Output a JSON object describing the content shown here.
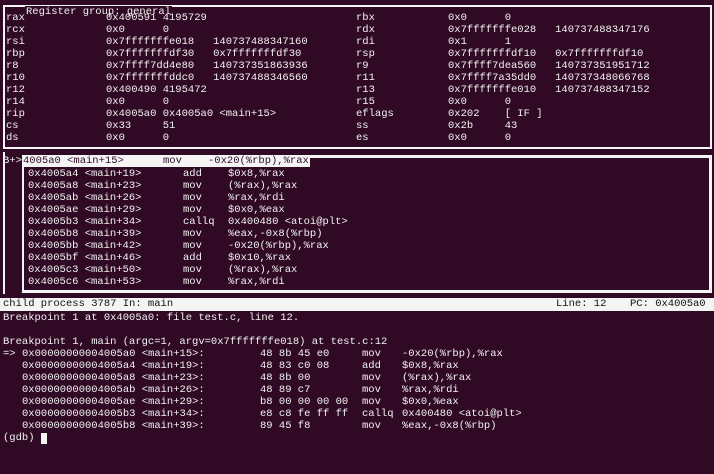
{
  "registers": {
    "title": "Register group: general",
    "left": [
      {
        "name": "rax",
        "value": "0x400591 4195729"
      },
      {
        "name": "rcx",
        "value": "0x0      0"
      },
      {
        "name": "rsi",
        "value": "0x7fffffffe018   140737488347160"
      },
      {
        "name": "rbp",
        "value": "0x7fffffffdf30   0x7fffffffdf30"
      },
      {
        "name": "r8",
        "value": "0x7ffff7dd4e80   140737351863936"
      },
      {
        "name": "r10",
        "value": "0x7fffffffddc0   140737488346560"
      },
      {
        "name": "r12",
        "value": "0x400490 4195472"
      },
      {
        "name": "r14",
        "value": "0x0      0"
      },
      {
        "name": "rip",
        "value": "0x4005a0 0x4005a0 <main+15>"
      },
      {
        "name": "cs",
        "value": "0x33     51"
      },
      {
        "name": "ds",
        "value": "0x0      0"
      }
    ],
    "right": [
      {
        "name": "rbx",
        "value": "0x0      0"
      },
      {
        "name": "rdx",
        "value": "0x7fffffffe028   140737488347176"
      },
      {
        "name": "rdi",
        "value": "0x1      1"
      },
      {
        "name": "rsp",
        "value": "0x7fffffffdf10   0x7fffffffdf10"
      },
      {
        "name": "r9",
        "value": "0x7ffff7dea560   140737351951712"
      },
      {
        "name": "r11",
        "value": "0x7ffff7a35dd0   140737348066768"
      },
      {
        "name": "r13",
        "value": "0x7fffffffe010   140737488347152"
      },
      {
        "name": "r15",
        "value": "0x0      0"
      },
      {
        "name": "eflags",
        "value": "0x202    [ IF ]"
      },
      {
        "name": "ss",
        "value": "0x2b     43"
      },
      {
        "name": "es",
        "value": "0x0      0"
      }
    ]
  },
  "asm": {
    "current": {
      "marker": "B+>",
      "addr": "4005a0 <main+15>",
      "mnem": "mov",
      "ops": "-0x20(%rbp),%rax"
    },
    "rows": [
      {
        "addr": "0x4005a4 <main+19>",
        "mnem": "add",
        "ops": "$0x8,%rax"
      },
      {
        "addr": "0x4005a8 <main+23>",
        "mnem": "mov",
        "ops": "(%rax),%rax"
      },
      {
        "addr": "0x4005ab <main+26>",
        "mnem": "mov",
        "ops": "%rax,%rdi"
      },
      {
        "addr": "0x4005ae <main+29>",
        "mnem": "mov",
        "ops": "$0x0,%eax"
      },
      {
        "addr": "0x4005b3 <main+34>",
        "mnem": "callq",
        "ops": "0x400480 <atoi@plt>"
      },
      {
        "addr": "0x4005b8 <main+39>",
        "mnem": "mov",
        "ops": "%eax,-0x8(%rbp)"
      },
      {
        "addr": "0x4005bb <main+42>",
        "mnem": "mov",
        "ops": "-0x20(%rbp),%rax"
      },
      {
        "addr": "0x4005bf <main+46>",
        "mnem": "add",
        "ops": "$0x10,%rax"
      },
      {
        "addr": "0x4005c3 <main+50>",
        "mnem": "mov",
        "ops": "(%rax),%rax"
      },
      {
        "addr": "0x4005c6 <main+53>",
        "mnem": "mov",
        "ops": "%rax,%rdi"
      }
    ]
  },
  "status": {
    "left": "child process 3787 In: main",
    "line": "Line: 12",
    "pc": "PC: 0x4005a0"
  },
  "console": {
    "lines": [
      "Breakpoint 1 at 0x4005a0: file test.c, line 12.",
      "",
      "Breakpoint 1, main (argc=1, argv=0x7fffffffe018) at test.c:12"
    ],
    "disasm": [
      {
        "prefix": "=>",
        "addr": "0x00000000004005a0 <main+15>:",
        "bytes": "48 8b 45 e0",
        "mnem": "mov",
        "ops": "-0x20(%rbp),%rax"
      },
      {
        "prefix": "",
        "addr": "0x00000000004005a4 <main+19>:",
        "bytes": "48 83 c0 08",
        "mnem": "add",
        "ops": "$0x8,%rax"
      },
      {
        "prefix": "",
        "addr": "0x00000000004005a8 <main+23>:",
        "bytes": "48 8b 00",
        "mnem": "mov",
        "ops": "(%rax),%rax"
      },
      {
        "prefix": "",
        "addr": "0x00000000004005ab <main+26>:",
        "bytes": "48 89 c7",
        "mnem": "mov",
        "ops": "%rax,%rdi"
      },
      {
        "prefix": "",
        "addr": "0x00000000004005ae <main+29>:",
        "bytes": "b8 00 00 00 00",
        "mnem": "mov",
        "ops": "$0x0,%eax"
      },
      {
        "prefix": "",
        "addr": "0x00000000004005b3 <main+34>:",
        "bytes": "e8 c8 fe ff ff",
        "mnem": "callq",
        "ops": "0x400480 <atoi@plt>"
      },
      {
        "prefix": "",
        "addr": "0x00000000004005b8 <main+39>:",
        "bytes": "89 45 f8",
        "mnem": "mov",
        "ops": "%eax,-0x8(%rbp)"
      }
    ],
    "prompt": "(gdb) "
  }
}
